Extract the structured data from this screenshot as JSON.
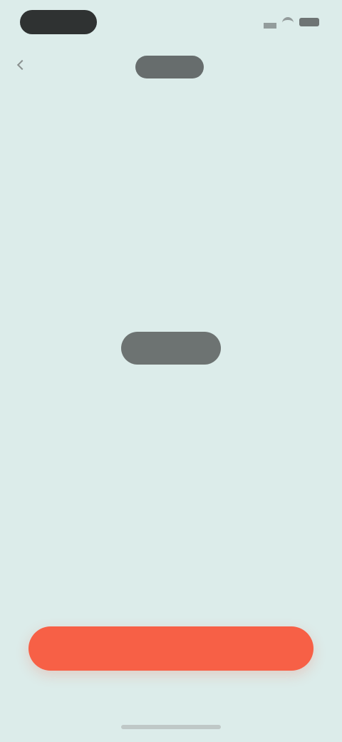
{
  "status_bar": {
    "time": "",
    "icons": [
      "signal-icon",
      "wifi-icon",
      "battery-icon"
    ]
  },
  "header": {
    "back_label": "",
    "title": ""
  },
  "empty_state": {
    "title": "",
    "description_line_1": "",
    "description_line_2": ""
  },
  "primary_action": {
    "label": ""
  },
  "colors": {
    "background": "#ddedea",
    "accent": "#f76046",
    "dark_text": "#3b3f3f",
    "muted_text": "#878d8c"
  }
}
